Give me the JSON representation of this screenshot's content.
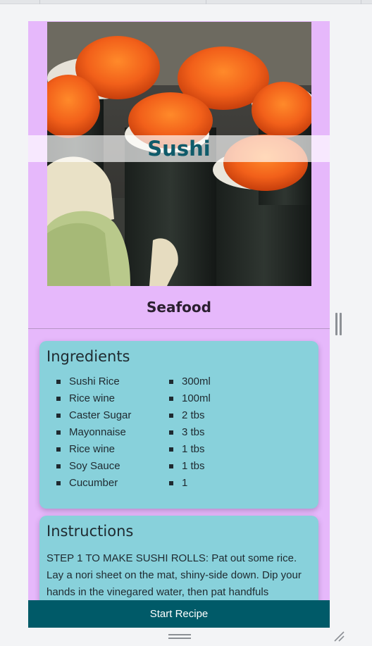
{
  "recipe": {
    "title": "Sushi",
    "category": "Seafood",
    "hero_image": "sushi-photo"
  },
  "ingredients": {
    "heading": "Ingredients",
    "names": [
      "Sushi Rice",
      "Rice wine",
      "Caster Sugar",
      "Mayonnaise",
      "Rice wine",
      "Soy Sauce",
      "Cucumber"
    ],
    "measures": [
      "300ml",
      "100ml",
      "2 tbs",
      "3 tbs",
      "1 tbs",
      "1 tbs",
      "1"
    ]
  },
  "instructions": {
    "heading": "Instructions",
    "text": "STEP 1 TO MAKE SUSHI ROLLS: Pat out some rice. Lay a nori sheet on the mat, shiny-side down. Dip your hands in the vinegared water, then pat handfuls"
  },
  "footer": {
    "start_label": "Start Recipe"
  },
  "colors": {
    "panel": "#e6b8fb",
    "card": "#88d1db",
    "accent": "#005a68",
    "title": "#0f5b6a"
  },
  "icons": {
    "drag": "vertical-drag-handle-icon",
    "bottom": "horizontal-drag-handle-icon",
    "resize": "resize-corner-icon"
  }
}
